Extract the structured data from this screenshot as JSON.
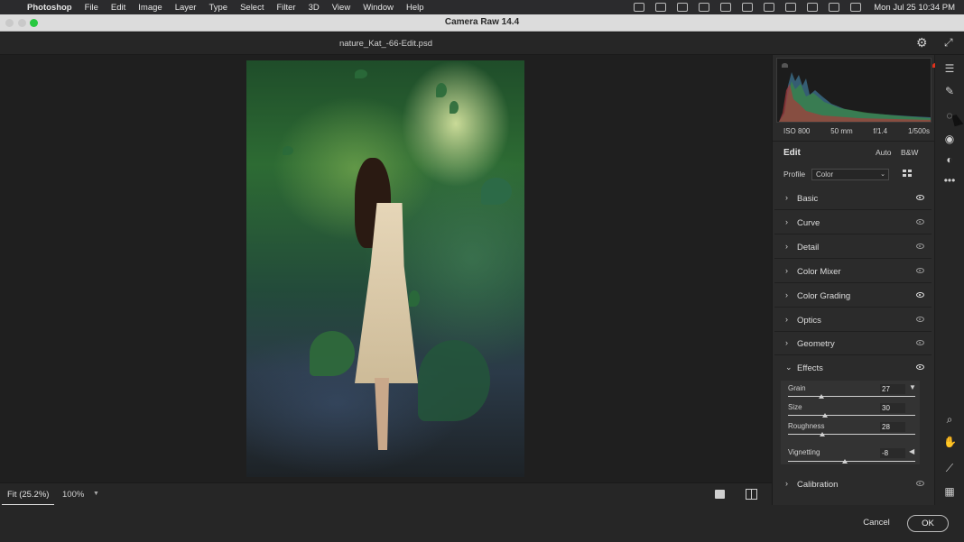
{
  "menubar": {
    "app": "Photoshop",
    "items": [
      "File",
      "Edit",
      "Image",
      "Layer",
      "Type",
      "Select",
      "Filter",
      "3D",
      "View",
      "Window",
      "Help"
    ],
    "clock": "Mon Jul 25  10:34 PM"
  },
  "window": {
    "title": "Camera Raw 14.4"
  },
  "document": {
    "filename": "nature_Kat_-66-Edit.psd"
  },
  "camera": {
    "iso": "ISO 800",
    "focal": "50 mm",
    "aperture": "f/1.4",
    "shutter": "1/500s"
  },
  "edit": {
    "title": "Edit",
    "auto": "Auto",
    "bw": "B&W",
    "profile_label": "Profile",
    "profile_value": "Color"
  },
  "sections": [
    {
      "name": "Basic",
      "expanded": false,
      "visible": true
    },
    {
      "name": "Curve",
      "expanded": false,
      "visible": false
    },
    {
      "name": "Detail",
      "expanded": false,
      "visible": false
    },
    {
      "name": "Color Mixer",
      "expanded": false,
      "visible": false
    },
    {
      "name": "Color Grading",
      "expanded": false,
      "visible": true
    },
    {
      "name": "Optics",
      "expanded": false,
      "visible": false
    },
    {
      "name": "Geometry",
      "expanded": false,
      "visible": false
    },
    {
      "name": "Effects",
      "expanded": true,
      "visible": true
    },
    {
      "name": "Calibration",
      "expanded": false,
      "visible": false
    }
  ],
  "effects": {
    "grain_label": "Grain",
    "grain_value": "27",
    "size_label": "Size",
    "size_value": "30",
    "roughness_label": "Roughness",
    "roughness_value": "28",
    "vignetting_label": "Vignetting",
    "vignetting_value": "-8"
  },
  "viewbar": {
    "fit": "Fit (25.2%)",
    "zoom": "100%"
  },
  "footer": {
    "cancel": "Cancel",
    "ok": "OK"
  },
  "colors": {
    "accent_red": "#e0321c",
    "panel_bg": "#2b2b2b"
  }
}
